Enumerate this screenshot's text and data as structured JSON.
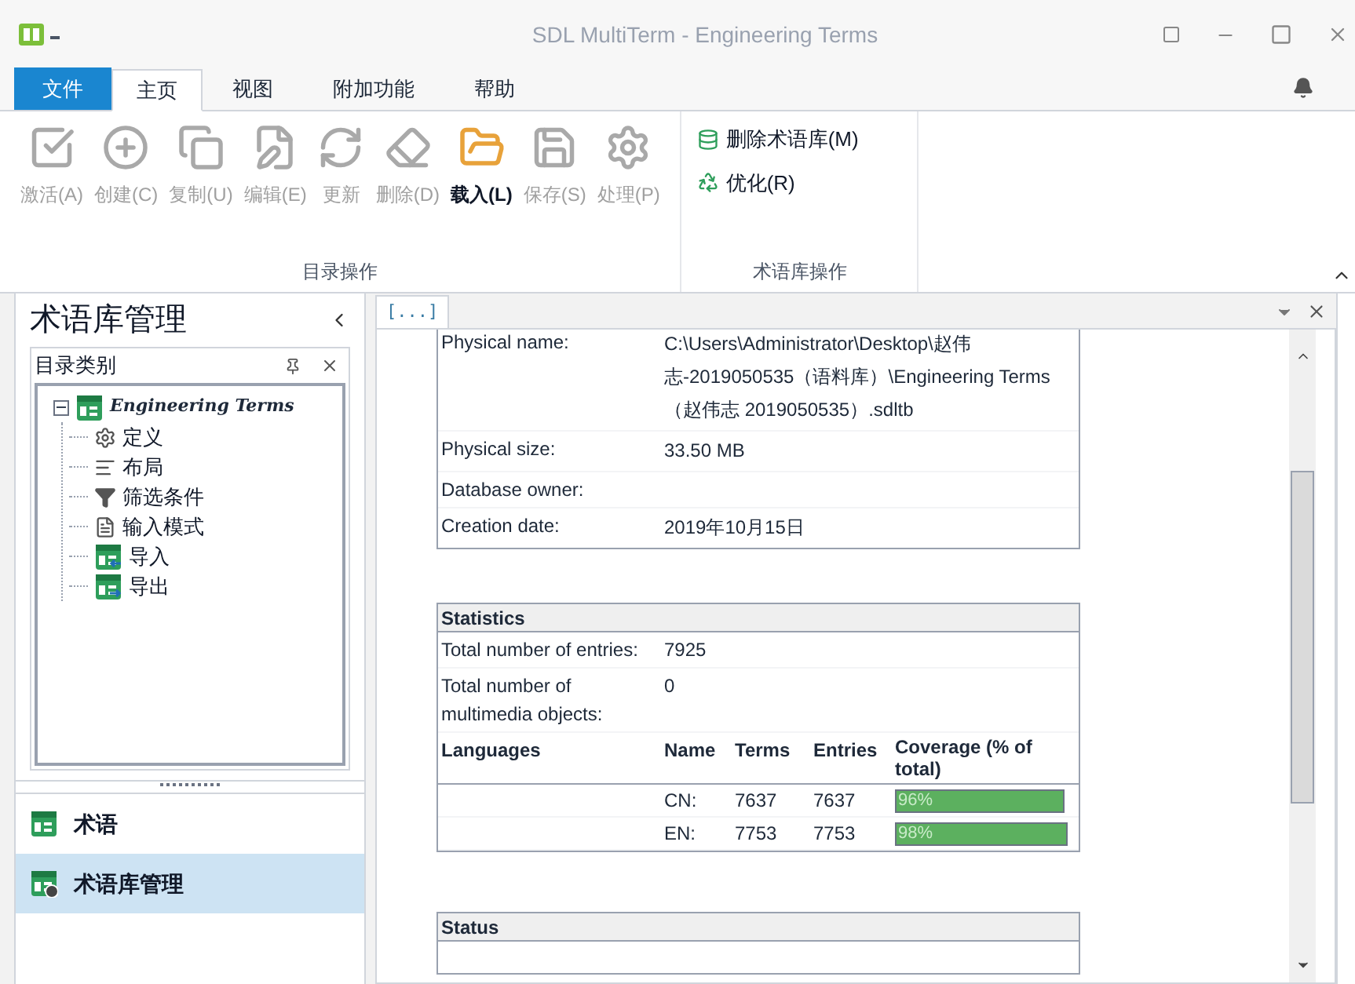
{
  "window": {
    "title": "SDL MultiTerm - Engineering Terms"
  },
  "menu_tabs": [
    {
      "label": "文件",
      "kind": "file",
      "selected": false
    },
    {
      "label": "主页",
      "kind": "tab",
      "selected": true
    },
    {
      "label": "视图",
      "kind": "tab",
      "selected": false
    },
    {
      "label": "附加功能",
      "kind": "tab",
      "selected": false
    },
    {
      "label": "帮助",
      "kind": "tab",
      "selected": false
    }
  ],
  "ribbon": {
    "groups": [
      {
        "label": "目录操作",
        "kind": "large",
        "buttons": [
          {
            "label": "激活(A)",
            "kind": "check",
            "disabled": true
          },
          {
            "label": "创建(C)",
            "kind": "plus",
            "disabled": true
          },
          {
            "label": "复制(U)",
            "kind": "copy",
            "disabled": true
          },
          {
            "label": "编辑(E)",
            "kind": "edit",
            "disabled": true
          },
          {
            "label": "更新",
            "kind": "refresh",
            "disabled": true
          },
          {
            "label": "删除(D)",
            "kind": "erase",
            "disabled": true
          },
          {
            "label": "载入(L)",
            "kind": "load",
            "disabled": false
          },
          {
            "label": "保存(S)",
            "kind": "save",
            "disabled": true
          },
          {
            "label": "处理(P)",
            "kind": "gear",
            "disabled": true
          }
        ]
      },
      {
        "label": "术语库操作",
        "kind": "small",
        "buttons": [
          {
            "label": "删除术语库(M)",
            "kind": "delete-db",
            "disabled": false
          },
          {
            "label": "优化(R)",
            "kind": "optimize",
            "disabled": false
          }
        ]
      }
    ]
  },
  "sidebar": {
    "title": "术语库管理",
    "panel_title": "目录类别",
    "tree": [
      {
        "label": "Engineering Terms",
        "kind": "db",
        "expanded": true,
        "children": [
          {
            "label": "定义",
            "kind": "gear"
          },
          {
            "label": "布局",
            "kind": "layout"
          },
          {
            "label": "筛选条件",
            "kind": "filter"
          },
          {
            "label": "输入模式",
            "kind": "form"
          },
          {
            "label": "导入",
            "kind": "import"
          },
          {
            "label": "导出",
            "kind": "export"
          }
        ]
      }
    ],
    "nav": [
      {
        "label": "术语",
        "kind": "terms",
        "selected": false
      },
      {
        "label": "术语库管理",
        "kind": "manage",
        "selected": true
      }
    ]
  },
  "document": {
    "tab": "[...]",
    "properties": [
      {
        "label": "Physical name:",
        "value": "C:\\Users\\Administrator\\Desktop\\赵伟志-2019050535（语料库）\\Engineering Terms（赵伟志 2019050535）.sdltb"
      },
      {
        "label": "Physical size:",
        "value": "33.50 MB"
      },
      {
        "label": "Database owner:"
      },
      {
        "label": "Creation date:",
        "value": "2019年10月15日"
      }
    ],
    "statistics": {
      "title": "Statistics",
      "rows": [
        {
          "label": "Total number of entries:",
          "value": "7925"
        },
        {
          "label": "Total number of multimedia objects:",
          "value": "0"
        }
      ],
      "columns": [
        "Languages",
        "Name",
        "Terms",
        "Entries",
        "Coverage (% of total)"
      ],
      "languages": [
        {
          "name": "CN:",
          "terms": "7637",
          "entries": "7637",
          "coverage": "96%",
          "level": 0.96
        },
        {
          "name": "EN:",
          "terms": "7753",
          "entries": "7753",
          "coverage": "98%",
          "level": 0.98
        }
      ]
    },
    "status": {
      "title": "Status"
    }
  }
}
